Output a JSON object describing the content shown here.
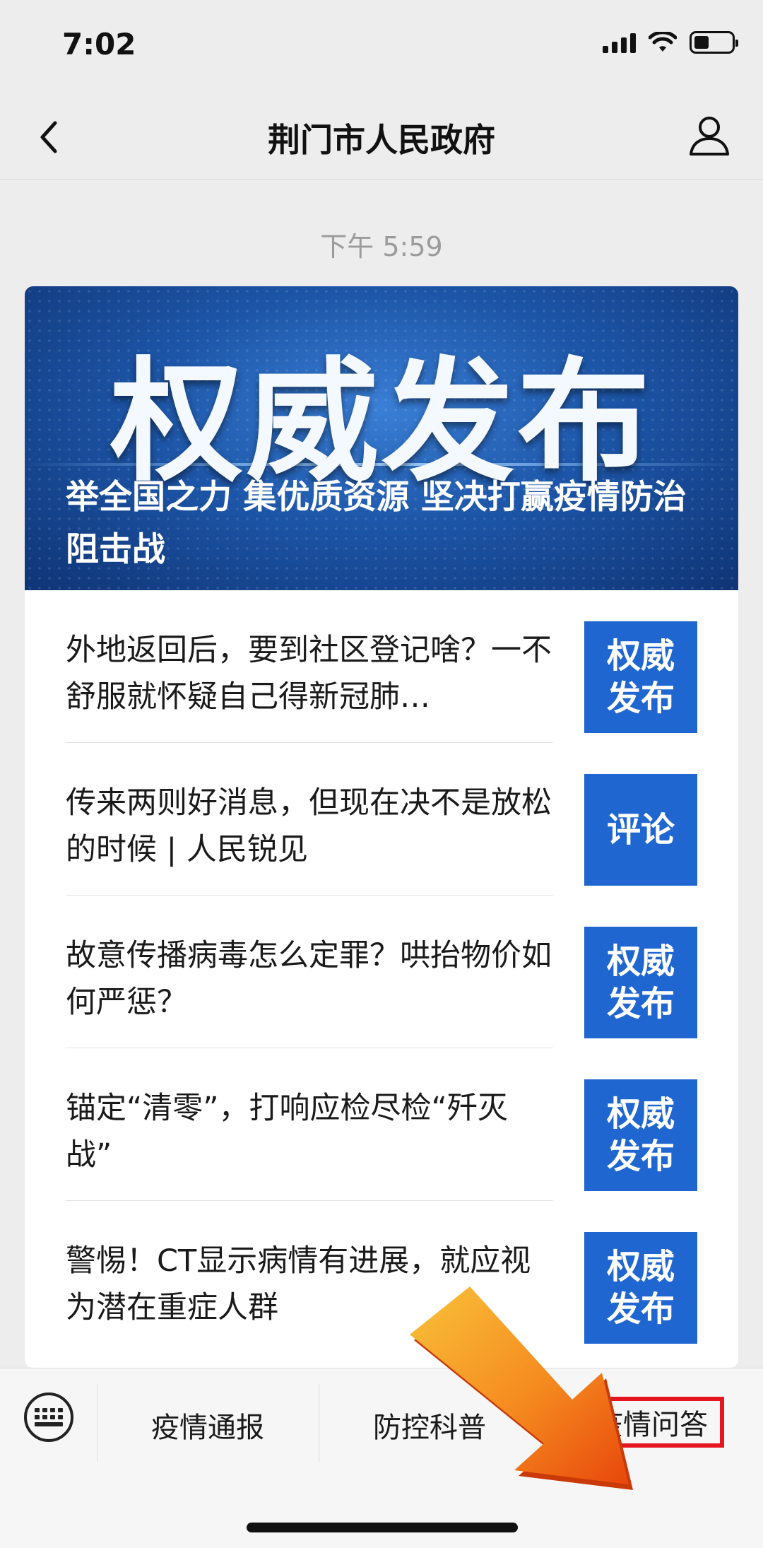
{
  "status_bar": {
    "time": "7:02"
  },
  "nav": {
    "title": "荆门市人民政府"
  },
  "message": {
    "time": "下午 5:59"
  },
  "banner": {
    "headline": "权威发布",
    "subtitle": "举全国之力 集优质资源 坚决打赢疫情防治阻击战"
  },
  "articles": [
    {
      "title": "外地返回后，要到社区登记啥？一不舒服就怀疑自己得新冠肺…",
      "tag": "权威发布"
    },
    {
      "title": "传来两则好消息，但现在决不是放松的时候 | 人民锐见",
      "tag": "评论"
    },
    {
      "title": "故意传播病毒怎么定罪？哄抬物价如何严惩？",
      "tag": "权威发布"
    },
    {
      "title": "锚定“清零”，打响应检尽检“歼灭战”",
      "tag": "权威发布"
    },
    {
      "title": "警惕！CT显示病情有进展，就应视为潜在重症人群",
      "tag": "权威发布"
    }
  ],
  "menu": {
    "items": [
      "疫情通报",
      "防控科普",
      "疫情问答"
    ]
  },
  "colors": {
    "tag_blue": "#1f66d1",
    "highlight_red": "#e4161f",
    "arrow_orange": "#f26a10"
  }
}
